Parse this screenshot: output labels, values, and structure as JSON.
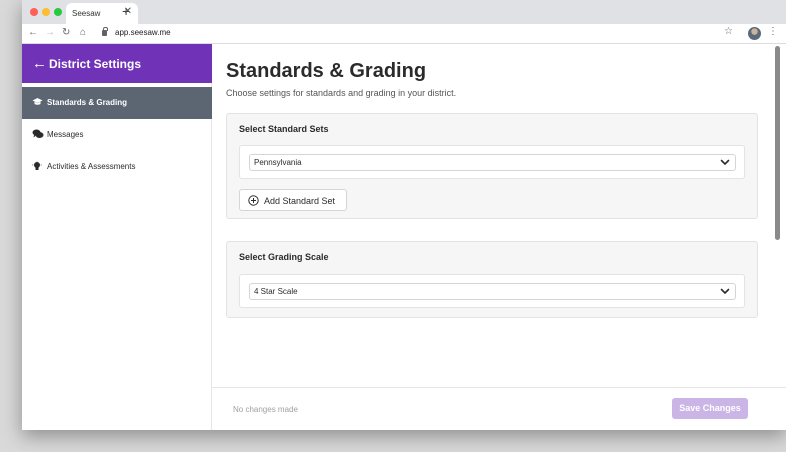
{
  "browser": {
    "tab_title": "Seesaw",
    "tab_close": "✕",
    "new_tab": "+",
    "url": "app.seesaw.me"
  },
  "sidebar": {
    "title": "District Settings",
    "items": [
      {
        "label": "Standards & Grading",
        "icon": "graduation-cap-icon",
        "active": true
      },
      {
        "label": "Messages",
        "icon": "chat-bubbles-icon",
        "active": false
      },
      {
        "label": "Activities & Assessments",
        "icon": "lightbulb-icon",
        "active": false
      }
    ]
  },
  "main": {
    "title": "Standards & Grading",
    "subtitle": "Choose settings for standards and grading in your district.",
    "standard_sets": {
      "title": "Select Standard Sets",
      "selected": "Pennsylvania",
      "add_label": "Add Standard Set"
    },
    "grading_scale": {
      "title": "Select Grading Scale",
      "selected": "4 Star Scale"
    }
  },
  "footer": {
    "status": "No changes made",
    "save_label": "Save Changes"
  },
  "colors": {
    "brand_purple": "#7033b8",
    "active_item": "#5c6672",
    "save_disabled": "#cbb4e6"
  }
}
